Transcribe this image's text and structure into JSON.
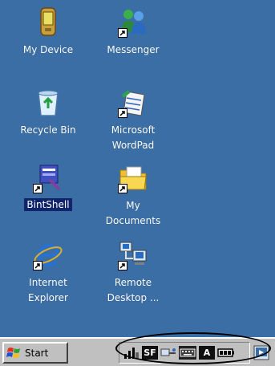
{
  "desktop": {
    "background_color": "#3a6ea5",
    "icons": [
      {
        "name": "my-device",
        "label": "My Device",
        "icon": "pda-device-icon",
        "shortcut": false
      },
      {
        "name": "messenger",
        "label": "Messenger",
        "icon": "messenger-people-icon",
        "shortcut": true
      },
      {
        "name": "recycle-bin",
        "label": "Recycle Bin",
        "icon": "recycle-bin-icon",
        "shortcut": false
      },
      {
        "name": "wordpad",
        "label": "Microsoft\nWordPad",
        "icon": "wordpad-icon",
        "shortcut": true
      },
      {
        "name": "bintshell",
        "label": "BintShell",
        "icon": "bintshell-icon",
        "shortcut": true,
        "selected": true
      },
      {
        "name": "my-documents",
        "label": "My\nDocuments",
        "icon": "folder-icon",
        "shortcut": true
      },
      {
        "name": "internet-explorer",
        "label": "Internet\nExplorer",
        "icon": "internet-explorer-icon",
        "shortcut": true
      },
      {
        "name": "remote-desktop",
        "label": "Remote\nDesktop ...",
        "icon": "remote-desktop-icon",
        "shortcut": true
      }
    ]
  },
  "taskbar": {
    "start_label": "Start",
    "tray_icons": [
      "signal-icon",
      "sf-icon",
      "network-icon",
      "keyboard-icon",
      "input-mode-icon",
      "battery-icon"
    ],
    "tray_labels": {
      "sf": "SF",
      "input_mode": "A"
    },
    "desktop_toggle_icon": "show-desktop-icon"
  }
}
